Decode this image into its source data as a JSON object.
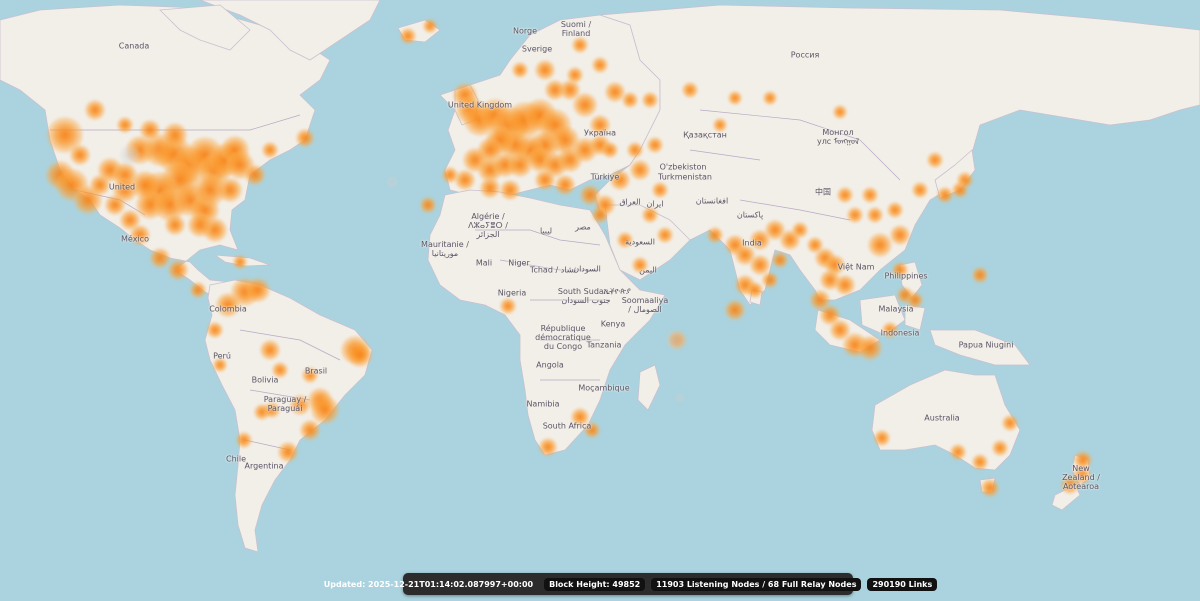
{
  "status": {
    "updated": "Updated: 2025-12-21T01:14:02.087997+00:00",
    "block_height": "Block Height: 49852",
    "nodes": "11903 Listening Nodes / 68 Full Relay Nodes",
    "links": "290190 Links"
  },
  "colors": {
    "ocean": "#aad3df",
    "land": "#f2efe9",
    "node": "#f7801a",
    "bar": "#2c2c2c"
  },
  "labels": [
    "Canada",
    "United",
    "México",
    "Colombia",
    "Perú",
    "Brasil",
    "Bolivia",
    "Paraguay / Paraguái",
    "Chile",
    "Argentina",
    "Norge",
    "Sverige",
    "Suomi / Finland",
    "United Kingdom",
    "Україна",
    "Türkiye",
    "Россия",
    "Қазақстан",
    "Монгол улс ᠮᠣᠩᠭᠣᠯ",
    "O'zbekiston",
    "Turkmenistan",
    "افغانستان",
    "ایران",
    "العراق",
    "پاکستان",
    "中国",
    "India",
    "Việt Nam",
    "Philippines",
    "Malaysia",
    "Indonesia",
    "Papua Niugini",
    "Australia",
    "New Zealand / Aotearoa",
    "Algérie / ⴷⵣⴰⵢⴻⵔ / الجزائر",
    "ليبيا",
    "مصر",
    "Mauritanie / موريتانيا",
    "Mali",
    "Niger",
    "Tchad / تشاد",
    "السودان",
    "Nigeria",
    "South Sudan / جنوب السودان",
    "ኢትዮጵያ",
    "Soomaaliya / الصومال",
    "République démocratique du Congo",
    "Kenya",
    "Tanzania",
    "Angola",
    "Moçambique",
    "Namibia",
    "South Africa",
    "السعودية",
    "اليمن",
    "ایران"
  ]
}
